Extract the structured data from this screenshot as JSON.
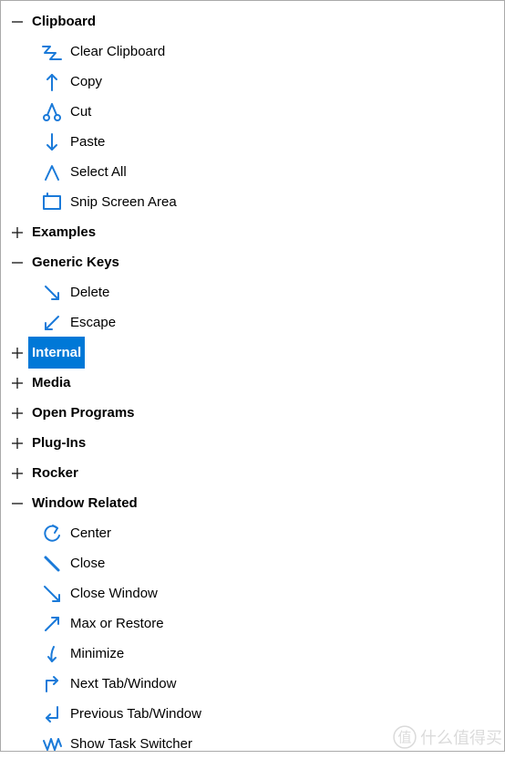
{
  "colors": {
    "accent": "#0078D7",
    "stroke": "#1a7ad9"
  },
  "watermark": {
    "word": "值",
    "text": "什么值得买"
  },
  "groups": [
    {
      "key": "clipboard",
      "label": "Clipboard",
      "expanded": true,
      "selected": false,
      "items": [
        {
          "key": "clear-clipboard",
          "label": "Clear Clipboard",
          "icon": "zigzag-icon"
        },
        {
          "key": "copy",
          "label": "Copy",
          "icon": "arrow-up-icon"
        },
        {
          "key": "cut",
          "label": "Cut",
          "icon": "scissors-loop-icon"
        },
        {
          "key": "paste",
          "label": "Paste",
          "icon": "arrow-down-icon"
        },
        {
          "key": "select-all",
          "label": "Select All",
          "icon": "caret-up-icon"
        },
        {
          "key": "snip-screen-area",
          "label": "Snip Screen Area",
          "icon": "snip-rect-icon"
        }
      ]
    },
    {
      "key": "examples",
      "label": "Examples",
      "expanded": false,
      "selected": false,
      "items": []
    },
    {
      "key": "generic-keys",
      "label": "Generic Keys",
      "expanded": true,
      "selected": false,
      "items": [
        {
          "key": "delete",
          "label": "Delete",
          "icon": "arrow-diag-dr-icon"
        },
        {
          "key": "escape",
          "label": "Escape",
          "icon": "arrow-diag-dl-icon"
        }
      ]
    },
    {
      "key": "internal",
      "label": "Internal",
      "expanded": false,
      "selected": true,
      "items": []
    },
    {
      "key": "media",
      "label": "Media",
      "expanded": false,
      "selected": false,
      "items": []
    },
    {
      "key": "open-programs",
      "label": "Open Programs",
      "expanded": false,
      "selected": false,
      "items": []
    },
    {
      "key": "plug-ins",
      "label": "Plug-Ins",
      "expanded": false,
      "selected": false,
      "items": []
    },
    {
      "key": "rocker",
      "label": "Rocker",
      "expanded": false,
      "selected": false,
      "items": []
    },
    {
      "key": "window-related",
      "label": "Window Related",
      "expanded": true,
      "selected": false,
      "items": [
        {
          "key": "center",
          "label": "Center",
          "icon": "rotate-ccw-icon"
        },
        {
          "key": "close",
          "label": "Close",
          "icon": "slash-dr-icon"
        },
        {
          "key": "close-window",
          "label": "Close Window",
          "icon": "arrow-diag-dr-long-icon"
        },
        {
          "key": "max-or-restore",
          "label": "Max or Restore",
          "icon": "arrow-diag-ur-icon"
        },
        {
          "key": "minimize",
          "label": "Minimize",
          "icon": "arrow-down-curved-icon"
        },
        {
          "key": "next-tab-window",
          "label": "Next Tab/Window",
          "icon": "step-right-icon"
        },
        {
          "key": "prev-tab-window",
          "label": "Previous Tab/Window",
          "icon": "step-left-icon"
        },
        {
          "key": "show-task-switcher",
          "label": "Show Task Switcher",
          "icon": "wave-icon"
        }
      ]
    }
  ]
}
